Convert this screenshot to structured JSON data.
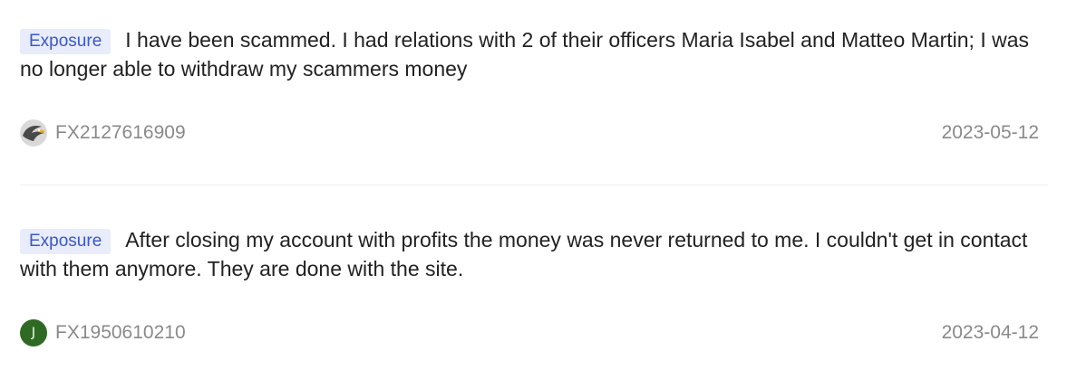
{
  "reviews": [
    {
      "tag": "Exposure",
      "text": "I have been scammed. I had relations with 2 of their officers Maria Isabel and Matteo Martin; I was no longer able to withdraw my scammers money",
      "user": "FX2127616909",
      "avatar": "eagle-icon",
      "date": "2023-05-12"
    },
    {
      "tag": "Exposure",
      "text": "After closing my account with profits the money was never returned to me. I couldn't get in contact with them anymore. They are done with the site.",
      "user": "FX1950610210",
      "avatar_letter": "J",
      "avatar_color": "#2e6a23",
      "date": "2023-04-12"
    }
  ]
}
